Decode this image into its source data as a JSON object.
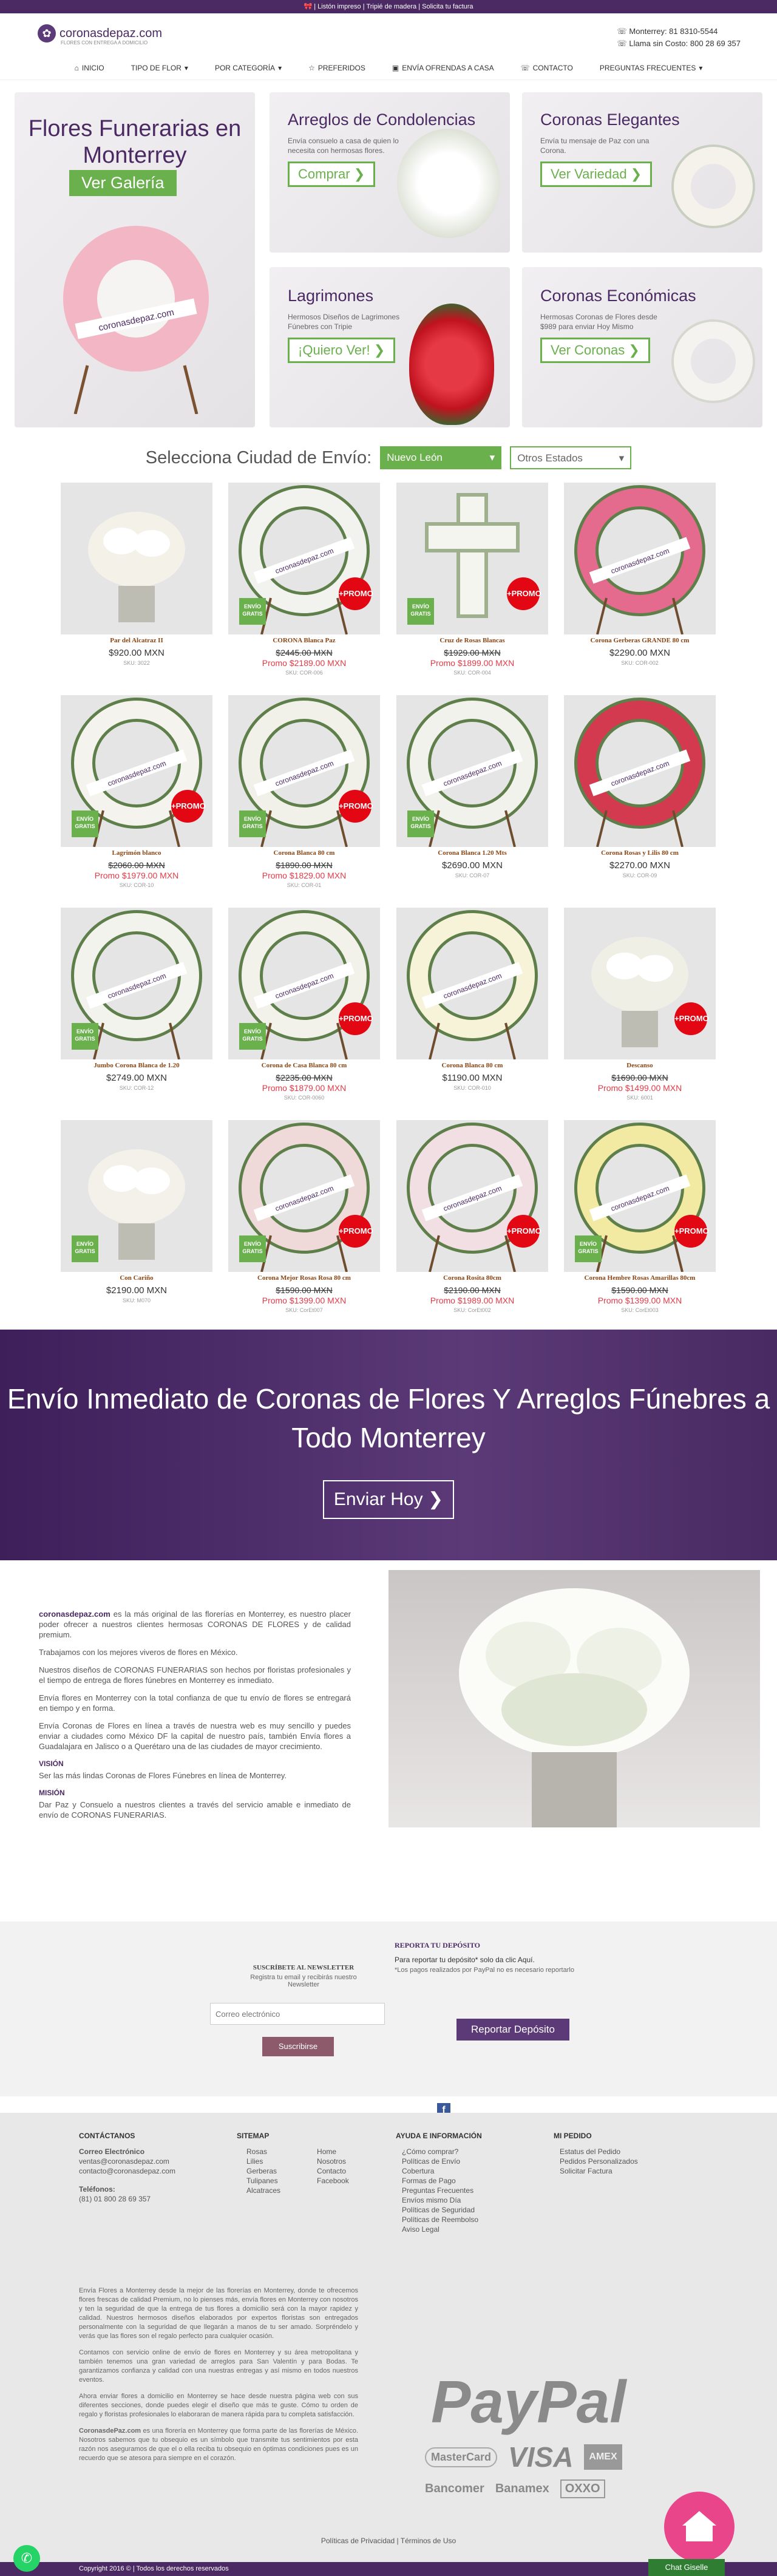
{
  "topbar": {
    "text": "🎀 | Listón impreso | Tripié de madera | Solicita tu factura"
  },
  "header": {
    "logo": "coronasdepaz.com",
    "logo_sub": "FLORES CON ENTREGA A DOMICILIO",
    "phone_mty": "Monterrey: 81 8310-5544",
    "phone_free": "Llama sin Costo: 800 28 69 357"
  },
  "nav": [
    {
      "label": "INICIO",
      "icon": "home-icon"
    },
    {
      "label": "TIPO DE FLOR",
      "icon": "chevron-down-icon"
    },
    {
      "label": "POR CATEGORÍA",
      "icon": "chevron-down-icon"
    },
    {
      "label": "PREFERIDOS",
      "icon": "star-icon"
    },
    {
      "label": "ENVÍA OFRENDAS A CASA",
      "icon": "gift-icon"
    },
    {
      "label": "CONTACTO",
      "icon": "phone-icon"
    },
    {
      "label": "PREGUNTAS FRECUENTES",
      "icon": "chevron-down-icon"
    }
  ],
  "hero": {
    "main_title": "Flores Funerarias en Monterrey",
    "main_btn": "Ver Galería",
    "main_ribbon": "coronasdepaz.com",
    "cards": [
      {
        "title": "Arreglos de Condolencias",
        "text": "Envía consuelo a casa de quien lo necesita con hermosas flores.",
        "btn": "Comprar"
      },
      {
        "title": "Coronas Elegantes",
        "text": "Envía tu mensaje de Paz con una Corona.",
        "btn": "Ver Variedad"
      },
      {
        "title": "Lagrimones",
        "text": "Hermosos Diseños de Lagrimones Fúnebres con Tripie",
        "btn": "¡Quiero Ver!"
      },
      {
        "title": "Coronas Económicas",
        "text": "Hermosas Coronas de Flores desde $989 para enviar Hoy Mismo",
        "btn": "Ver Coronas"
      }
    ]
  },
  "city": {
    "label": "Selecciona Ciudad de Envío:",
    "selected": "Nuevo León",
    "other": "Otros Estados"
  },
  "badges": {
    "envio": "ENVÍO GRATIS",
    "promo": "+PROMO",
    "ribbon": "coronasdepaz.com"
  },
  "products": [
    {
      "name": "Par del Alcatraz II",
      "price": "$920.00 MXN",
      "sku": "SKU: 3022",
      "envio": false,
      "promo": false,
      "kind": "vase",
      "c": "#f3f1e8"
    },
    {
      "name": "CORONA Blanca Paz",
      "old": "$2445.00 MXN",
      "new": "Promo $2189.00 MXN",
      "sku": "SKU: COR-006",
      "envio": true,
      "promo": true,
      "kind": "wreath",
      "c": "#f2f2ee"
    },
    {
      "name": "Cruz de Rosas Blancas",
      "old": "$1929.00 MXN",
      "new": "Promo $1899.00 MXN",
      "sku": "SKU: COR-004",
      "envio": true,
      "promo": true,
      "kind": "cross",
      "c": "#f5f5f0"
    },
    {
      "name": "Corona Gerberas GRANDE 80 cm",
      "price": "$2290.00 MXN",
      "sku": "SKU: COR-002",
      "envio": false,
      "promo": false,
      "kind": "wreath",
      "c": "#e46b8e"
    },
    {
      "name": "Lagrimón blanco",
      "old": "$2060.00 MXN",
      "new": "Promo $1979.00 MXN",
      "sku": "SKU: COR-10",
      "envio": true,
      "promo": true,
      "kind": "wreath",
      "c": "#f4f3ee"
    },
    {
      "name": "Corona Blanca 80 cm",
      "old": "$1890.00 MXN",
      "new": "Promo $1829.00 MXN",
      "sku": "SKU: COR-01",
      "envio": true,
      "promo": true,
      "kind": "wreath",
      "c": "#f1f1ea"
    },
    {
      "name": "Corona Blanca 1.20 Mts",
      "price": "$2690.00 MXN",
      "sku": "SKU: COR-07",
      "envio": true,
      "promo": false,
      "kind": "wreath",
      "c": "#f2f2ec"
    },
    {
      "name": "Corona Rosas y Lilis 80 cm",
      "price": "$2270.00 MXN",
      "sku": "SKU: COR-09",
      "envio": false,
      "promo": false,
      "kind": "wreath",
      "c": "#d43a4f"
    },
    {
      "name": "Jumbo Corona Blanca de 1.20",
      "price": "$2749.00 MXN",
      "sku": "SKU: COR-12",
      "envio": true,
      "promo": false,
      "kind": "wreath",
      "c": "#f3f3ee"
    },
    {
      "name": "Corona de Casa Blanca 80 cm",
      "old": "$2235.00 MXN",
      "new": "Promo $1879.00 MXN",
      "sku": "SKU: COR-0060",
      "envio": true,
      "promo": true,
      "kind": "wreath",
      "c": "#f2f2ea"
    },
    {
      "name": "Corona Blanca 80 cm",
      "price": "$1190.00 MXN",
      "sku": "SKU: COR-010",
      "envio": false,
      "promo": false,
      "kind": "wreath",
      "c": "#f6f3d8"
    },
    {
      "name": "Descanso",
      "old": "$1690.00 MXN",
      "new": "Promo $1499.00 MXN",
      "sku": "SKU: 6001",
      "envio": false,
      "promo": true,
      "kind": "vase",
      "c": "#efefe6"
    },
    {
      "name": "Con Cariño",
      "price": "$2190.00 MXN",
      "sku": "SKU: M070",
      "envio": true,
      "promo": false,
      "kind": "vase",
      "c": "#f3f1ea"
    },
    {
      "name": "Corona Mejor Rosas Rosa 80 cm",
      "old": "$1590.00 MXN",
      "new": "Promo $1399.00 MXN",
      "sku": "SKU: CorEt007",
      "envio": true,
      "promo": true,
      "kind": "wreath",
      "c": "#f0d9d9"
    },
    {
      "name": "Corona Rosita 80cm",
      "old": "$2190.00 MXN",
      "new": "Promo $1989.00 MXN",
      "sku": "SKU: CorEt002",
      "envio": false,
      "promo": true,
      "kind": "wreath",
      "c": "#f1dfe4"
    },
    {
      "name": "Corona Hembre Rosas Amarillas 80cm",
      "old": "$1590.00 MXN",
      "new": "Promo $1399.00 MXN",
      "sku": "SKU: CorEt003",
      "envio": true,
      "promo": true,
      "kind": "wreath",
      "c": "#f2eaa2"
    }
  ],
  "banner": {
    "title": "Envío Inmediato de Coronas de Flores Y Arreglos Fúnebres a Todo Monterrey",
    "btn": "Enviar Hoy"
  },
  "about": {
    "p1_brand": "coronasdepaz.com",
    "p1": "es la más original de las florerías en Monterrey, es nuestro placer poder ofrecer a nuestros clientes hermosas CORONAS DE FLORES y de calidad premium.",
    "p2": "Trabajamos con los mejores viveros de flores en México.",
    "p3": "Nuestros diseños de CORONAS FUNERARIAS son hechos por floristas profesionales y el tiempo de entrega de flores fúnebres en Monterrey es inmediato.",
    "p4": "Envía flores en Monterrey con la total confianza de que tu envío de flores se entregará en tiempo y en forma.",
    "p5": "Envía Coronas de Flores en línea a través de nuestra web es muy sencillo y puedes enviar a ciudades como México DF la capital de nuestro país, también Envía flores a Guadalajara en Jalisco o a Querétaro una de las ciudades de mayor crecimiento.",
    "vision_h": "VISIÓN",
    "vision": "Ser las más lindas Coronas de Flores Fúnebres en línea de Monterrey.",
    "mision_h": "MISIÓN",
    "mision": "Dar Paz y Consuelo a nuestros clientes a través del servicio amable e inmediato de envío de CORONAS FUNERARIAS."
  },
  "subscribe": {
    "title": "SUSCRÍBETE AL NEWSLETTER",
    "text": "Registra tu email y recibirás nuestro Newsletter",
    "placeholder": "Correo electrónico",
    "btn": "Suscribirse",
    "report_title": "REPORTA TU DEPÓSITO",
    "report_text": "Para reportar tu depósito* solo da clic Aquí.",
    "report_note": "*Los pagos realizados por PayPal no es necesario reportarlo",
    "report_btn": "Reportar Depósito"
  },
  "footer": {
    "contact_h": "CONTÁCTANOS",
    "email_h": "Correo Electrónico",
    "email1": "ventas@coronasdepaz.com",
    "email2": "contacto@coronasdepaz.com",
    "phone_h": "Teléfonos:",
    "phone": "(81) 01 800 28 69 357",
    "sitemap_h": "SITEMAP",
    "sitemap_a": [
      "Rosas",
      "Lilies",
      "Gerberas",
      "Tulipanes",
      "Alcatraces"
    ],
    "sitemap_b": [
      "Home",
      "Nosotros",
      "Contacto",
      "Facebook"
    ],
    "help_h": "AYUDA E INFORMACIÓN",
    "help": [
      "¿Cómo comprar?",
      "Políticas de Envío",
      "Cobertura",
      "Formas de Pago",
      "Preguntas Frecuentes",
      "Envíos mismo Día",
      "Políticas de Seguridad",
      "Políticas de Reembolso",
      "Aviso Legal"
    ],
    "order_h": "MI PEDIDO",
    "order": [
      "Estatus del Pedido",
      "Pedidos Personalizados",
      "Solicitar Factura"
    ],
    "long1": "Envía Flores a Monterrey desde la mejor de las florerías en Monterrey, donde te ofrecemos flores frescas de calidad Premium, no lo pienses más, envía flores en Monterrey con nosotros y ten la seguridad de que la entrega de tus flores a domicilio será con la mayor rapidez y calidad. Nuestros hermosos diseños elaborados por expertos floristas son entregados personalmente con la seguridad de que llegarán a manos de tu ser amado. Sorpréndelo y verás que las flores son el regalo perfecto para cualquier ocasión.",
    "long2": "Contamos con servicio online de envío de flores en Monterrey y su área metropolitana y también tenemos una gran variedad de arreglos para San Valentín y para Bodas. Te garantizamos confianza y calidad con una nuestras entregas y así mismo en todos nuestros eventos.",
    "long3": "Ahora enviar flores a domicilio en Monterrey se hace desde nuestra página web con sus diferentes secciones, donde puedes elegir el diseño que más te guste. Cómo tu orden de regalo y floristas profesionales lo elaboraran de manera rápida para tu completa satisfacción.",
    "long4_brand": "CoronasdePaz.com",
    "long4": "es una florería en Monterrey que forma parte de las florerías de México. Nosotros sabemos que tu obsequio es un símbolo que transmite tus sentimientos por esta razón nos aseguramos de que el o ella reciba tu obsequio en óptimas condiciones pues es un recuerdo que se atesora para siempre en el corazón.",
    "paypal": "PayPal",
    "cards": [
      "MasterCard",
      "VISA",
      "AMEX",
      "Bancomer",
      "Banamex",
      "OXXO"
    ],
    "privacy": "Políticas de Privacidad | Términos de Uso",
    "copyright": "Copyright 2016 © | Todos los derechos reservados",
    "chat": "Chat Giselle"
  }
}
